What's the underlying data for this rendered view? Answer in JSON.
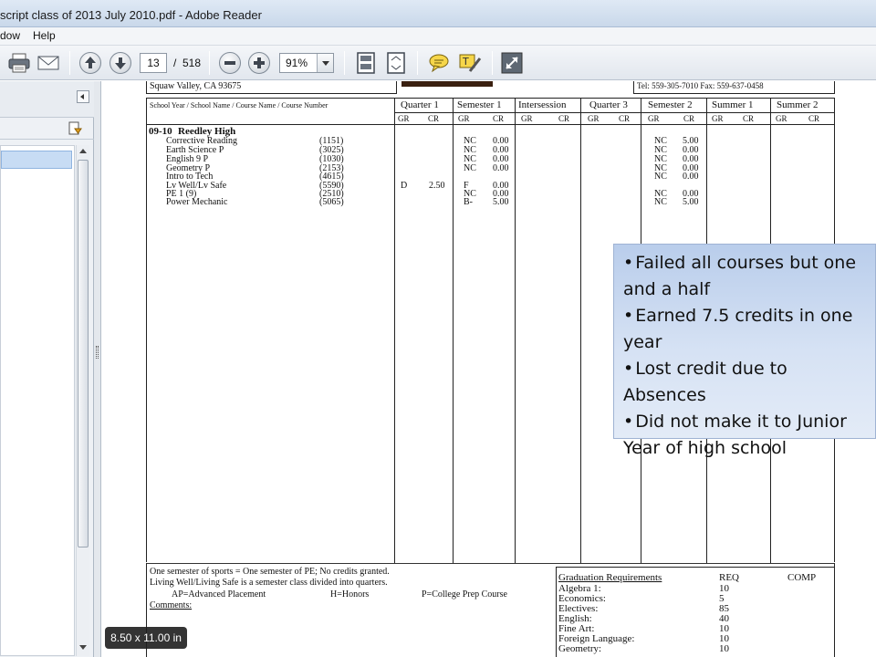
{
  "window": {
    "title": "script class of 2013 July 2010.pdf - Adobe Reader"
  },
  "menu": {
    "items": [
      "dow",
      "Help"
    ]
  },
  "toolbar": {
    "page_current": "13",
    "page_separator": "/",
    "page_total": "518",
    "zoom": "91%"
  },
  "status": {
    "page_size": "8.50 x 11.00 in"
  },
  "doc": {
    "address": "Squaw Valley, CA 93675",
    "contact": "Tel: 559-305-7010 Fax: 559-637-0458",
    "col_header_main": "School Year / School Name / Course Name / Course Number",
    "periods": [
      "Quarter 1",
      "Semester 1",
      "Intersession",
      "Quarter 3",
      "Semester 2",
      "Summer 1",
      "Summer 2"
    ],
    "gr": "GR",
    "cr": "CR",
    "school_year": "09-10",
    "school_name": "Reedley High",
    "courses": [
      {
        "name": "Corrective Reading",
        "number": "(1151)",
        "s1_gr": "NC",
        "s1_cr": "0.00",
        "s2_gr": "NC",
        "s2_cr": "5.00"
      },
      {
        "name": "Earth Science P",
        "number": "(3025)",
        "s1_gr": "NC",
        "s1_cr": "0.00",
        "s2_gr": "NC",
        "s2_cr": "0.00"
      },
      {
        "name": "English 9 P",
        "number": "(1030)",
        "s1_gr": "NC",
        "s1_cr": "0.00",
        "s2_gr": "NC",
        "s2_cr": "0.00"
      },
      {
        "name": "Geometry P",
        "number": "(2153)",
        "s1_gr": "NC",
        "s1_cr": "0.00",
        "s2_gr": "NC",
        "s2_cr": "0.00"
      },
      {
        "name": "Intro to Tech",
        "number": "(4615)",
        "s1_gr": "",
        "s1_cr": "",
        "s2_gr": "NC",
        "s2_cr": "0.00"
      },
      {
        "name": "Lv Well/Lv Safe",
        "number": "(5590)",
        "q1_gr": "D",
        "q1_cr": "2.50",
        "s1_gr": "F",
        "s1_cr": "0.00"
      },
      {
        "name": "PE 1 (9)",
        "number": "(2510)",
        "s1_gr": "NC",
        "s1_cr": "0.00",
        "s2_gr": "NC",
        "s2_cr": "0.00"
      },
      {
        "name": "Power Mechanic",
        "number": "(5065)",
        "s1_gr": "B-",
        "s1_cr": "5.00",
        "s2_gr": "NC",
        "s2_cr": "5.00"
      }
    ],
    "footer": {
      "line1": "One semester of sports = One semester of PE; No credits granted.",
      "line2": "Living Well/Living Safe is a semester class divided into quarters.",
      "ap": "AP=Advanced Placement",
      "honors": "H=Honors",
      "prep": "P=College Prep Course",
      "comments": "Comments:"
    },
    "grad": {
      "title": "Graduation Requirements",
      "req": "REQ",
      "comp": "COMP",
      "rows": [
        {
          "subject": "Algebra 1:",
          "req": "10"
        },
        {
          "subject": "Economics:",
          "req": "5"
        },
        {
          "subject": "Electives:",
          "req": "85"
        },
        {
          "subject": "English:",
          "req": "40"
        },
        {
          "subject": "Fine Art:",
          "req": "10"
        },
        {
          "subject": "Foreign Language:",
          "req": "10"
        },
        {
          "subject": "Geometry:",
          "req": "10"
        }
      ]
    }
  },
  "callout": {
    "bullets": [
      "Failed all courses but one and a half",
      "Earned 7.5 credits in one year",
      "Lost credit due to Absences",
      "Did not make it to Junior Year of high school"
    ]
  },
  "icons": {
    "print": "printer-icon",
    "email": "envelope-icon",
    "prev": "arrow-up-icon",
    "next": "arrow-down-icon",
    "zoom_out": "minus-icon",
    "zoom_in": "plus-icon",
    "fit_page": "fit-page-icon",
    "fit_width": "fit-width-icon",
    "comment": "speech-bubble-icon",
    "highlight": "highlight-text-icon",
    "fullscreen": "expand-icon"
  }
}
